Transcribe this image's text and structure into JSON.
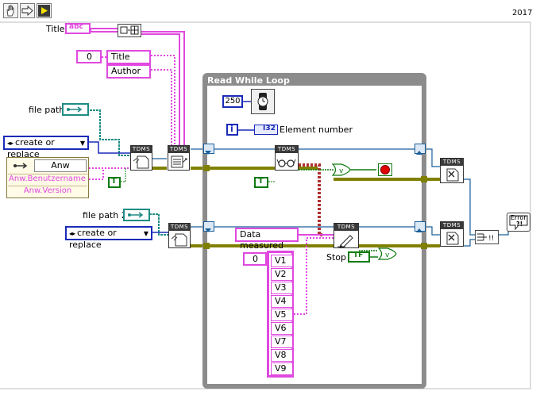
{
  "toolbar": {
    "version": "2017"
  },
  "front": {
    "title_label": "Title",
    "title_const": "abc",
    "array_index": "0",
    "metadata_items": [
      "Title",
      "Author"
    ],
    "file_path_label": "file path",
    "file_path_2_label": "file path 2",
    "operation_1": "create or replace",
    "operation_2": "create or replace",
    "cluster_name": "Anw",
    "cluster_field_1": "Anw.Benutzername",
    "cluster_field_2": "Anw.Version",
    "bool_true_1": "T",
    "bool_true_2": "T"
  },
  "loop": {
    "title": "Read While Loop",
    "wait_ms": "250",
    "iteration": "i",
    "element_number_type": "I32",
    "element_number_label": "Element number",
    "group_name": "Data measured",
    "channels_index": "0",
    "channels": [
      "V1",
      "V2",
      "V3",
      "V4",
      "V5",
      "V6",
      "V7",
      "V8",
      "V9"
    ],
    "stop_label": "Stop",
    "stop_tf": "TF"
  },
  "nodes": {
    "tdms_label": "TDMS",
    "error_label": "Error"
  },
  "colors": {
    "string_wire": "#e048e0",
    "refnum_wire": "#808000",
    "boolean_wire": "#0f7a0f",
    "path_wire": "#1e8c84",
    "enum_wire": "#1a2ab8",
    "loop_frame": "#8c8c8c"
  }
}
